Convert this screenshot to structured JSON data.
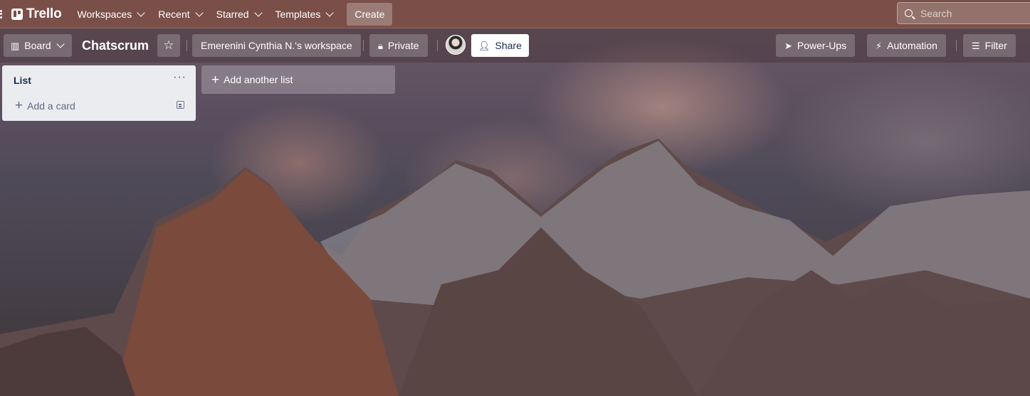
{
  "topnav": {
    "brand": "Trello",
    "menus": [
      "Workspaces",
      "Recent",
      "Starred",
      "Templates"
    ],
    "create_label": "Create",
    "search_placeholder": "Search"
  },
  "board": {
    "view_label": "Board",
    "title": "Chatscrum",
    "workspace_label": "Emerenini Cynthia N.'s workspace",
    "visibility_label": "Private",
    "share_label": "Share",
    "powerups_label": "Power-Ups",
    "automation_label": "Automation",
    "filter_label": "Filter"
  },
  "lists": [
    {
      "title": "List",
      "add_card_label": "Add a card"
    }
  ],
  "add_list_label": "Add another list",
  "colors": {
    "nav_bg": "#7a4f48",
    "list_bg": "#ebecf0",
    "text_dark": "#172b4d"
  }
}
